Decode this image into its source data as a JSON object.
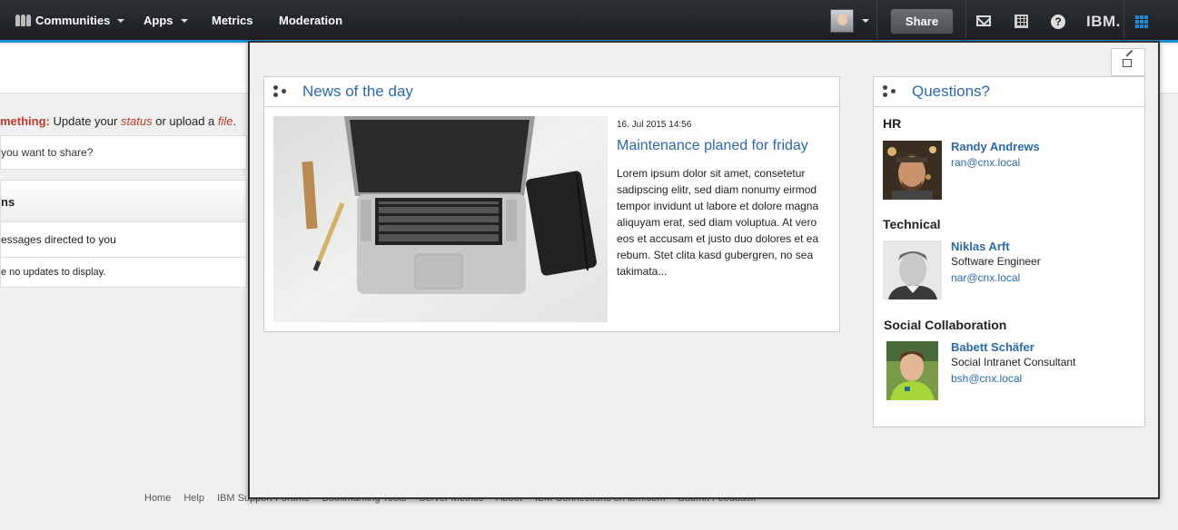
{
  "nav": {
    "communities": "Communities",
    "apps": "Apps",
    "metrics": "Metrics",
    "moderation": "Moderation",
    "share": "Share",
    "ibm": "IBM."
  },
  "background": {
    "prompt_highlight": "mething:",
    "prompt_text1": " Update your ",
    "prompt_link1": "status",
    "prompt_text2": " or upload a ",
    "prompt_link2": "file",
    "prompt_text3": ".",
    "share_placeholder": "you want to share?",
    "section_label": "ns",
    "messages_label": "essages directed to you",
    "no_updates": "e no updates to display."
  },
  "footer": {
    "links": [
      "Home",
      "Help",
      "IBM Support Forums",
      "Bookmarking Tools",
      "Server Metrics",
      "About",
      "IBM Connections on ibm.com",
      "Submit Feedback"
    ]
  },
  "news": {
    "title": "News of the day",
    "date": "16. Jul 2015 14:56",
    "headline": "Maintenance planed for friday",
    "body": "Lorem ipsum dolor sit amet, consetetur sadipscing elitr, sed diam nonumy eirmod tempor invidunt ut labore et dolore magna aliquyam erat, sed diam voluptua. At vero eos et accusam et justo duo dolores et ea rebum. Stet clita kasd gubergren, no sea takimata..."
  },
  "questions": {
    "title": "Questions?",
    "contacts": [
      {
        "category": "HR",
        "name": "Randy Andrews",
        "role": "",
        "email": "ran@cnx.local"
      },
      {
        "category": "Technical",
        "name": "Niklas Arft",
        "role": "Software Engineer",
        "email": "nar@cnx.local"
      },
      {
        "category": "Social Collaboration",
        "name": "Babett Schäfer",
        "role": "Social Intranet Consultant",
        "email": "bsh@cnx.local"
      }
    ]
  },
  "colors": {
    "accent": "#1d8dd6",
    "link": "#2b6aa6",
    "highlight": "#c0392b"
  }
}
